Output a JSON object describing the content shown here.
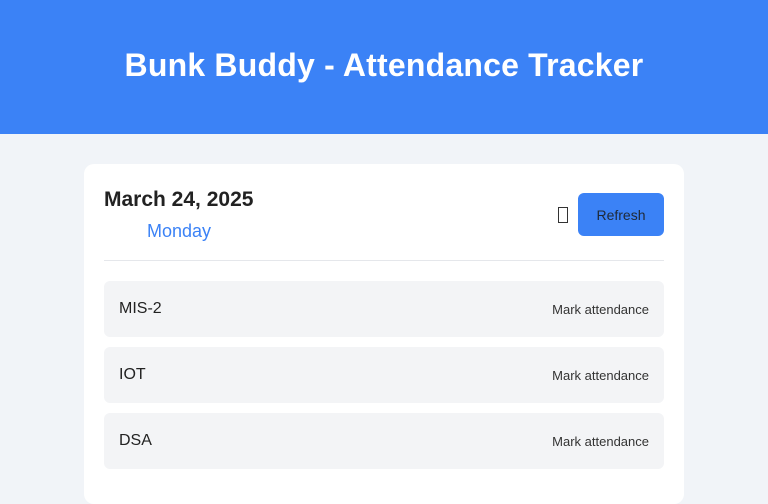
{
  "header": {
    "title": "Bunk Buddy - Attendance Tracker"
  },
  "date_panel": {
    "date": "March 24, 2025",
    "day": "Monday",
    "calendar_icon": "calendar-icon",
    "refresh_label": "Refresh"
  },
  "subjects": [
    {
      "name": "MIS-2",
      "action": "Mark attendance"
    },
    {
      "name": "IOT",
      "action": "Mark attendance"
    },
    {
      "name": "DSA",
      "action": "Mark attendance"
    }
  ],
  "colors": {
    "accent": "#3b82f6",
    "background": "#f1f4f8",
    "row": "#f3f4f6"
  }
}
